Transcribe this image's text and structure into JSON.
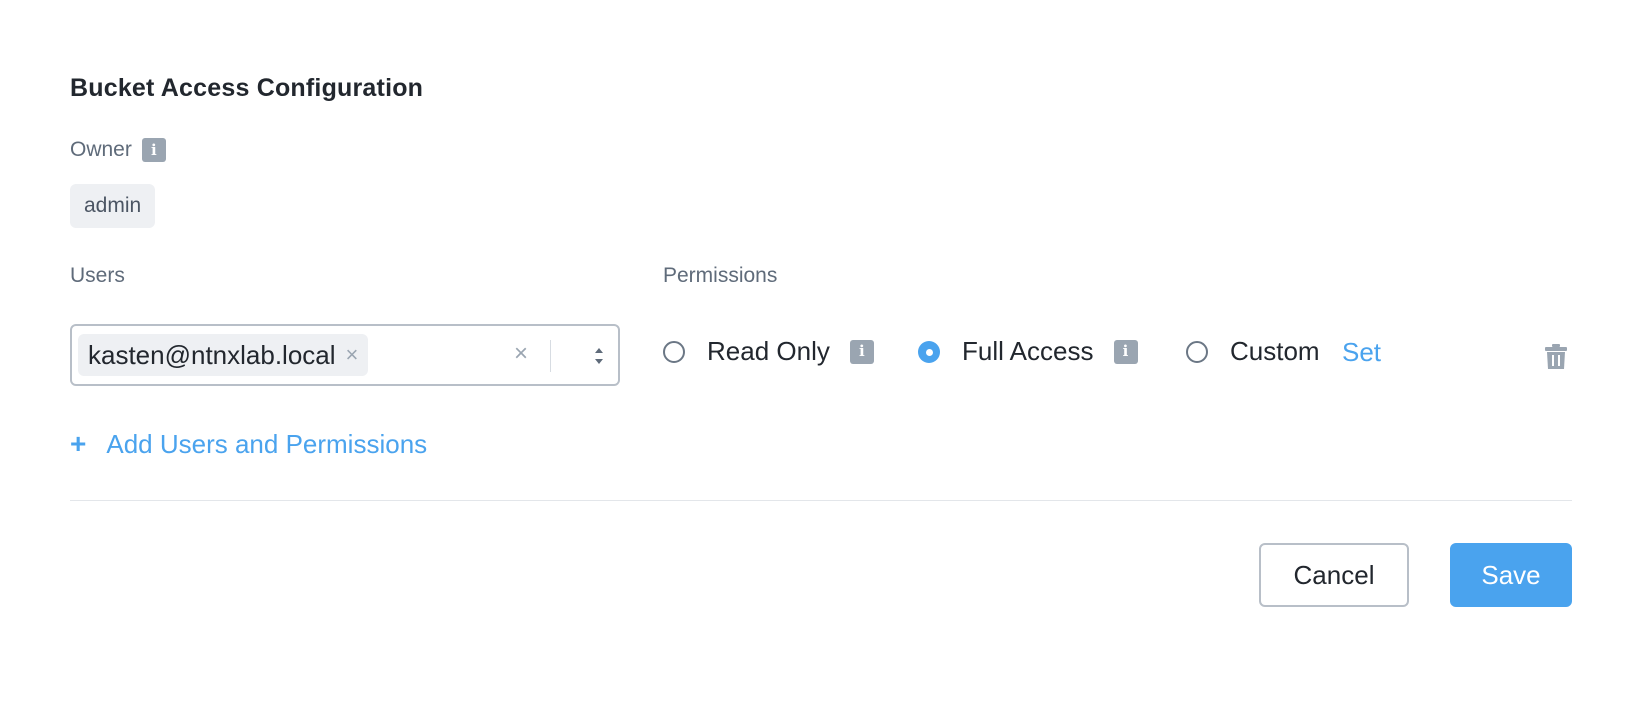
{
  "dialog": {
    "title": "Bucket Access Configuration"
  },
  "owner": {
    "label": "Owner",
    "value": "admin",
    "info_icon": "info-icon"
  },
  "users": {
    "label": "Users",
    "selected": [
      "kasten@ntnxlab.local"
    ],
    "chip_remove_glyph": "×",
    "clear_glyph": "×"
  },
  "permissions": {
    "label": "Permissions",
    "options": [
      {
        "label": "Read Only",
        "checked": false,
        "has_info": true
      },
      {
        "label": "Full Access",
        "checked": true,
        "has_info": true
      },
      {
        "label": "Custom",
        "checked": false,
        "has_info": false
      }
    ],
    "custom_link": "Set",
    "accent_color": "#4aa3ee"
  },
  "add_action": {
    "plus": "+",
    "label": "Add Users and Permissions"
  },
  "footer": {
    "cancel_label": "Cancel",
    "save_label": "Save"
  }
}
